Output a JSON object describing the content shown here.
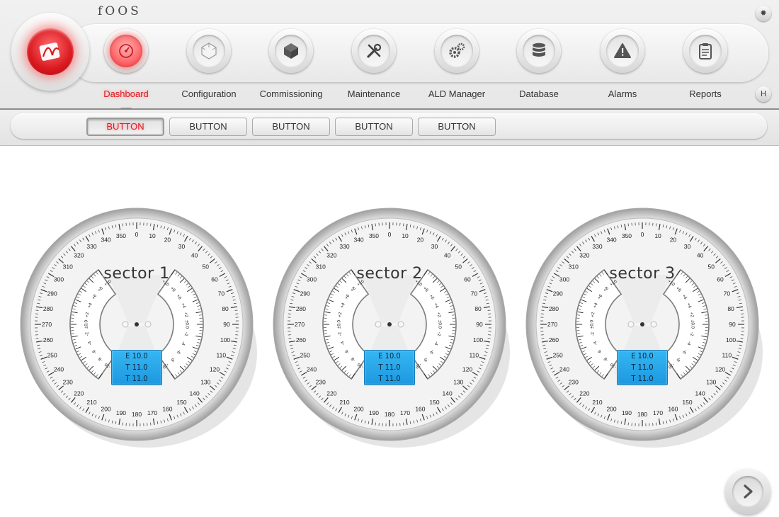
{
  "app": {
    "brand": "fOOS"
  },
  "header": {
    "nav": [
      {
        "label": "Dashboard",
        "icon": "dashboard-gauge-icon",
        "active": true
      },
      {
        "label": "Configuration",
        "icon": "cube-outline-icon",
        "active": false
      },
      {
        "label": "Commissioning",
        "icon": "cube-solid-icon",
        "active": false
      },
      {
        "label": "Maintenance",
        "icon": "tools-icon",
        "active": false
      },
      {
        "label": "ALD Manager",
        "icon": "gears-icon",
        "active": false
      },
      {
        "label": "Database",
        "icon": "database-icon",
        "active": false
      },
      {
        "label": "Alarms",
        "icon": "warning-icon",
        "active": false
      },
      {
        "label": "Reports",
        "icon": "clipboard-icon",
        "active": false
      }
    ],
    "help_label": "H",
    "settings_icon": "gear-icon"
  },
  "subbar": {
    "buttons": [
      {
        "label": "BUTTON",
        "active": true
      },
      {
        "label": "BUTTON",
        "active": false
      },
      {
        "label": "BUTTON",
        "active": false
      },
      {
        "label": "BUTTON",
        "active": false
      },
      {
        "label": "BUTTON",
        "active": false
      }
    ]
  },
  "gauges": [
    {
      "title": "sector 1",
      "readout": [
        "E 10.0",
        "T 11.0",
        "T 11.0"
      ]
    },
    {
      "title": "sector 2",
      "readout": [
        "E 10.0",
        "T 11.0",
        "T 11.0"
      ]
    },
    {
      "title": "sector 3",
      "readout": [
        "E 10.0",
        "T 11.0",
        "T 11.0"
      ]
    }
  ],
  "gauge_scale": {
    "azimuth_labels": [
      "0",
      "10",
      "20",
      "30",
      "40",
      "50",
      "60",
      "70",
      "80",
      "90",
      "100",
      "110",
      "120",
      "130",
      "140",
      "150",
      "160",
      "170",
      "180",
      "190",
      "200",
      "210",
      "220",
      "230",
      "240",
      "250",
      "260",
      "270",
      "280",
      "290",
      "300",
      "310",
      "320",
      "330",
      "340",
      "350"
    ],
    "tilt_labels": [
      "+10",
      "+8",
      "+6",
      "+4",
      "+2",
      "±0.0",
      "-2",
      "-4",
      "-6",
      "-8",
      "-10"
    ]
  },
  "colors": {
    "accent_red": "#e0181f",
    "readout_blue": "#2aa8ec"
  }
}
